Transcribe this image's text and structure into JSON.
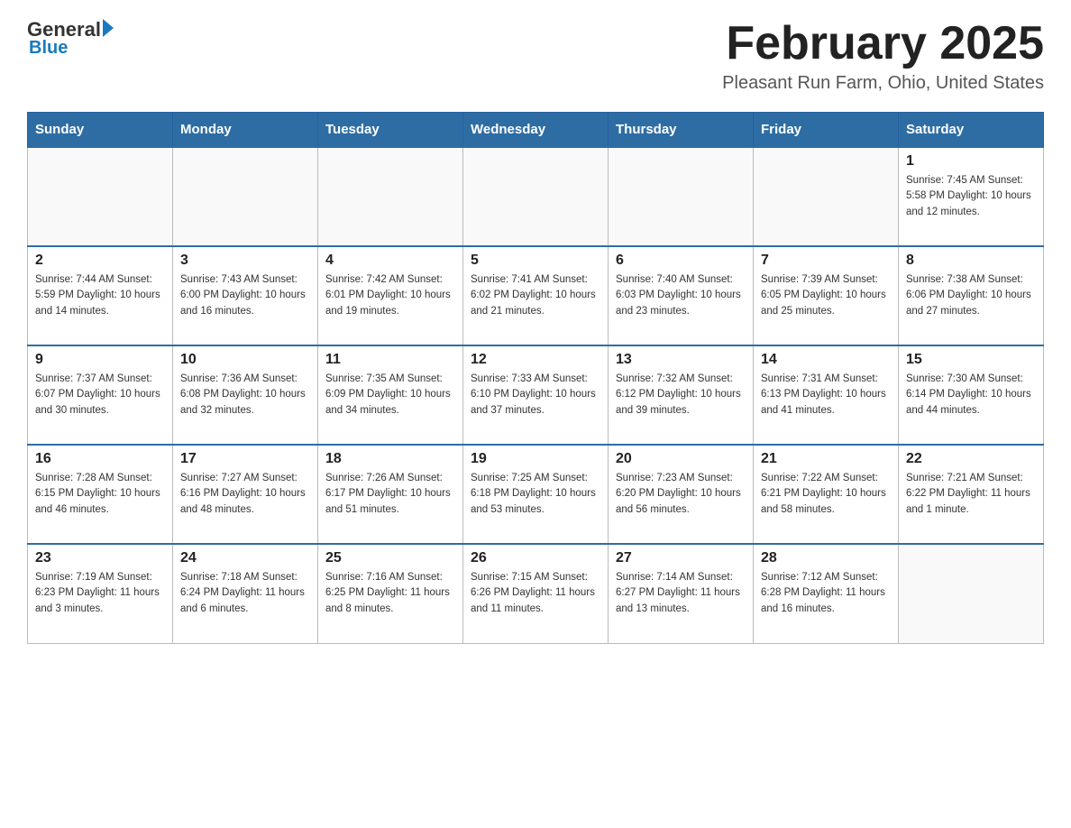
{
  "header": {
    "logo_general": "General",
    "logo_blue": "Blue",
    "month_title": "February 2025",
    "location": "Pleasant Run Farm, Ohio, United States"
  },
  "days_of_week": [
    "Sunday",
    "Monday",
    "Tuesday",
    "Wednesday",
    "Thursday",
    "Friday",
    "Saturday"
  ],
  "weeks": [
    [
      {
        "day": "",
        "info": ""
      },
      {
        "day": "",
        "info": ""
      },
      {
        "day": "",
        "info": ""
      },
      {
        "day": "",
        "info": ""
      },
      {
        "day": "",
        "info": ""
      },
      {
        "day": "",
        "info": ""
      },
      {
        "day": "1",
        "info": "Sunrise: 7:45 AM\nSunset: 5:58 PM\nDaylight: 10 hours and 12 minutes."
      }
    ],
    [
      {
        "day": "2",
        "info": "Sunrise: 7:44 AM\nSunset: 5:59 PM\nDaylight: 10 hours and 14 minutes."
      },
      {
        "day": "3",
        "info": "Sunrise: 7:43 AM\nSunset: 6:00 PM\nDaylight: 10 hours and 16 minutes."
      },
      {
        "day": "4",
        "info": "Sunrise: 7:42 AM\nSunset: 6:01 PM\nDaylight: 10 hours and 19 minutes."
      },
      {
        "day": "5",
        "info": "Sunrise: 7:41 AM\nSunset: 6:02 PM\nDaylight: 10 hours and 21 minutes."
      },
      {
        "day": "6",
        "info": "Sunrise: 7:40 AM\nSunset: 6:03 PM\nDaylight: 10 hours and 23 minutes."
      },
      {
        "day": "7",
        "info": "Sunrise: 7:39 AM\nSunset: 6:05 PM\nDaylight: 10 hours and 25 minutes."
      },
      {
        "day": "8",
        "info": "Sunrise: 7:38 AM\nSunset: 6:06 PM\nDaylight: 10 hours and 27 minutes."
      }
    ],
    [
      {
        "day": "9",
        "info": "Sunrise: 7:37 AM\nSunset: 6:07 PM\nDaylight: 10 hours and 30 minutes."
      },
      {
        "day": "10",
        "info": "Sunrise: 7:36 AM\nSunset: 6:08 PM\nDaylight: 10 hours and 32 minutes."
      },
      {
        "day": "11",
        "info": "Sunrise: 7:35 AM\nSunset: 6:09 PM\nDaylight: 10 hours and 34 minutes."
      },
      {
        "day": "12",
        "info": "Sunrise: 7:33 AM\nSunset: 6:10 PM\nDaylight: 10 hours and 37 minutes."
      },
      {
        "day": "13",
        "info": "Sunrise: 7:32 AM\nSunset: 6:12 PM\nDaylight: 10 hours and 39 minutes."
      },
      {
        "day": "14",
        "info": "Sunrise: 7:31 AM\nSunset: 6:13 PM\nDaylight: 10 hours and 41 minutes."
      },
      {
        "day": "15",
        "info": "Sunrise: 7:30 AM\nSunset: 6:14 PM\nDaylight: 10 hours and 44 minutes."
      }
    ],
    [
      {
        "day": "16",
        "info": "Sunrise: 7:28 AM\nSunset: 6:15 PM\nDaylight: 10 hours and 46 minutes."
      },
      {
        "day": "17",
        "info": "Sunrise: 7:27 AM\nSunset: 6:16 PM\nDaylight: 10 hours and 48 minutes."
      },
      {
        "day": "18",
        "info": "Sunrise: 7:26 AM\nSunset: 6:17 PM\nDaylight: 10 hours and 51 minutes."
      },
      {
        "day": "19",
        "info": "Sunrise: 7:25 AM\nSunset: 6:18 PM\nDaylight: 10 hours and 53 minutes."
      },
      {
        "day": "20",
        "info": "Sunrise: 7:23 AM\nSunset: 6:20 PM\nDaylight: 10 hours and 56 minutes."
      },
      {
        "day": "21",
        "info": "Sunrise: 7:22 AM\nSunset: 6:21 PM\nDaylight: 10 hours and 58 minutes."
      },
      {
        "day": "22",
        "info": "Sunrise: 7:21 AM\nSunset: 6:22 PM\nDaylight: 11 hours and 1 minute."
      }
    ],
    [
      {
        "day": "23",
        "info": "Sunrise: 7:19 AM\nSunset: 6:23 PM\nDaylight: 11 hours and 3 minutes."
      },
      {
        "day": "24",
        "info": "Sunrise: 7:18 AM\nSunset: 6:24 PM\nDaylight: 11 hours and 6 minutes."
      },
      {
        "day": "25",
        "info": "Sunrise: 7:16 AM\nSunset: 6:25 PM\nDaylight: 11 hours and 8 minutes."
      },
      {
        "day": "26",
        "info": "Sunrise: 7:15 AM\nSunset: 6:26 PM\nDaylight: 11 hours and 11 minutes."
      },
      {
        "day": "27",
        "info": "Sunrise: 7:14 AM\nSunset: 6:27 PM\nDaylight: 11 hours and 13 minutes."
      },
      {
        "day": "28",
        "info": "Sunrise: 7:12 AM\nSunset: 6:28 PM\nDaylight: 11 hours and 16 minutes."
      },
      {
        "day": "",
        "info": ""
      }
    ]
  ]
}
